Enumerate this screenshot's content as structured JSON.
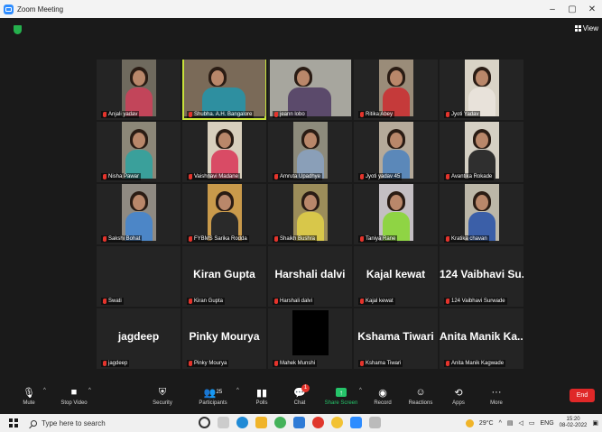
{
  "window": {
    "title": "Zoom Meeting",
    "controls": [
      "–",
      "▢",
      "✕"
    ]
  },
  "view": {
    "label": "View"
  },
  "tiles": [
    {
      "name": "Anjali yadav",
      "video": true,
      "bg": "#6f6a5e",
      "shirt": "#c2455a"
    },
    {
      "name": "Shubha. A.H. Bangalore",
      "video": true,
      "active": true,
      "wide": true,
      "bg": "#7a6a58",
      "shirt": "#2e8fa0"
    },
    {
      "name": "jeann lobo",
      "video": true,
      "wide": true,
      "bg": "#a7a69e",
      "shirt": "#5b4a6b"
    },
    {
      "name": "Ritika Abey",
      "video": true,
      "bg": "#9a8c79",
      "shirt": "#c53a3a"
    },
    {
      "name": "Jyoti Yadav",
      "video": true,
      "bg": "#d9d3c6",
      "shirt": "#e8e2da"
    },
    {
      "name": "Nisha Pawar",
      "video": true,
      "bg": "#8c8778",
      "shirt": "#3aa09b"
    },
    {
      "name": "Vaishnavi Madane",
      "video": true,
      "bg": "#d8cfbd",
      "shirt": "#d94b65"
    },
    {
      "name": "Amruta Upadhye",
      "video": true,
      "bg": "#8d8b7c",
      "shirt": "#8a9fb8"
    },
    {
      "name": "Jyoti yadav 45",
      "video": true,
      "bg": "#b5aa9a",
      "shirt": "#5b88b9"
    },
    {
      "name": "Avantika Rokade",
      "video": true,
      "bg": "#d5d0c4",
      "shirt": "#2f2f2f"
    },
    {
      "name": "Sakshi Bohat",
      "video": true,
      "bg": "#8f8a82",
      "shirt": "#4c86c7"
    },
    {
      "name": "FYBMS Sarika Rodda",
      "video": true,
      "bg": "#c99a4b",
      "shirt": "#2a2a2a"
    },
    {
      "name": "Shaikh Bushra",
      "video": true,
      "bg": "#9c8d5a",
      "shirt": "#d8c74a"
    },
    {
      "name": "Taniya Rane",
      "video": true,
      "bg": "#c4bfc3",
      "shirt": "#8fd444"
    },
    {
      "name": "Kratika chavan",
      "video": true,
      "bg": "#bcb7a8",
      "shirt": "#3b5fa8"
    },
    {
      "name": "Swati",
      "big": "",
      "video": false
    },
    {
      "name": "Kiran Gupta",
      "big": "Kiran Gupta",
      "video": false
    },
    {
      "name": "Harshali dalvi",
      "big": "Harshali dalvi",
      "video": false
    },
    {
      "name": "Kajal kewat",
      "big": "Kajal kewat",
      "video": false
    },
    {
      "name": "124 Vaibhavi Surwade",
      "big": "124 Vaibhavi Su...",
      "video": false
    },
    {
      "name": "jagdeep",
      "big": "jagdeep",
      "video": false
    },
    {
      "name": "Pinky Mourya",
      "big": "Pinky Mourya",
      "video": false
    },
    {
      "name": "Mahek Munshi",
      "big": "",
      "video": false,
      "black": true
    },
    {
      "name": "Kshama Tiwari",
      "big": "Kshama Tiwari",
      "video": false
    },
    {
      "name": "Anita Manik Kagwade",
      "big": "Anita Manik Ka...",
      "video": false
    }
  ],
  "toolbar": {
    "mute": "Mute",
    "stop_video": "Stop Video",
    "security": "Security",
    "participants": "Participants",
    "participants_count": "25",
    "polls": "Polls",
    "chat": "Chat",
    "chat_badge": "1",
    "share_screen": "Share Screen",
    "record": "Record",
    "reactions": "Reactions",
    "apps": "Apps",
    "more": "More",
    "end": "End"
  },
  "taskbar": {
    "search_placeholder": "Type here to search",
    "weather": "29°C",
    "lang": "ENG",
    "time": "15:20",
    "date": "08-02-2022"
  },
  "colors": {
    "accent_green": "#25c46a",
    "end_red": "#e02828",
    "active_border": "#c7e13a",
    "muted_red": "#e5342c"
  }
}
